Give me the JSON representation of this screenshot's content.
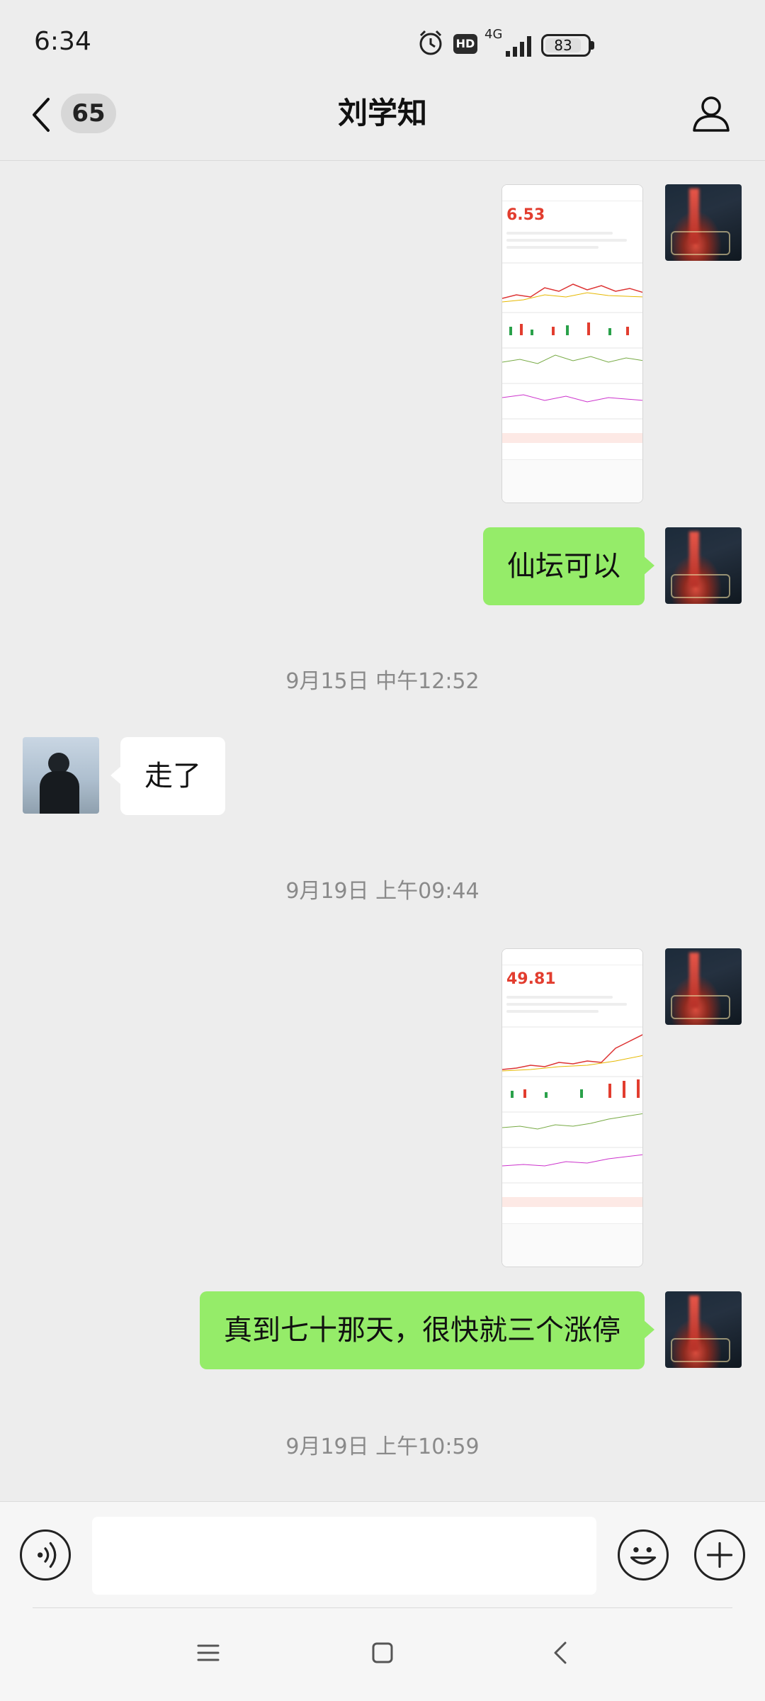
{
  "status_bar": {
    "time": "6:34",
    "hd_label": "HD",
    "network": "4G",
    "battery": "83"
  },
  "header": {
    "unread_count": "65",
    "title": "刘学知"
  },
  "messages": [
    {
      "type": "image",
      "sender": "me",
      "thumbnail": {
        "price": "6.53"
      }
    },
    {
      "type": "text",
      "sender": "me",
      "text": "仙坛可以"
    },
    {
      "type": "timestamp",
      "text": "9月15日 中午12:52"
    },
    {
      "type": "text",
      "sender": "them",
      "text": "走了"
    },
    {
      "type": "timestamp",
      "text": "9月19日 上午09:44"
    },
    {
      "type": "image",
      "sender": "me",
      "thumbnail": {
        "price": "49.81"
      }
    },
    {
      "type": "text",
      "sender": "me",
      "text": "真到七十那天，很快就三个涨停"
    },
    {
      "type": "timestamp",
      "text": "9月19日 上午10:59"
    }
  ],
  "input": {
    "value": ""
  },
  "colors": {
    "background": "#ededed",
    "my_bubble": "#95ec69",
    "their_bubble": "#ffffff",
    "timestamp": "#8a8a8a"
  },
  "icons": {
    "back": "chevron-left-icon",
    "profile": "person-icon",
    "voice": "voice-icon",
    "emoji": "emoji-icon",
    "plus": "plus-icon"
  }
}
